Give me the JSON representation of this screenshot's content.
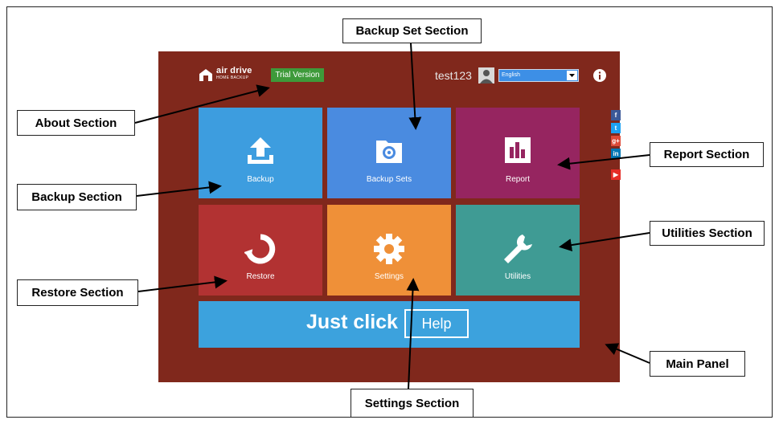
{
  "app": {
    "brand": "air drive",
    "brand_sub": "HOME BACKUP",
    "trial_label": "Trial Version",
    "username": "test123",
    "language": "English"
  },
  "tiles": [
    {
      "label": "Backup",
      "color": "#3d9ddf",
      "icon": "upload-icon"
    },
    {
      "label": "Backup Sets",
      "color": "#4a8be0",
      "icon": "folder-gear-icon"
    },
    {
      "label": "Report",
      "color": "#962560",
      "icon": "bar-chart-icon"
    },
    {
      "label": "Restore",
      "color": "#b23232",
      "icon": "restore-icon"
    },
    {
      "label": "Settings",
      "color": "#ef9038",
      "icon": "gear-icon"
    },
    {
      "label": "Utilities",
      "color": "#3f9b94",
      "icon": "wrench-icon"
    }
  ],
  "help_bar": {
    "text": "Just click",
    "button_label": "Help"
  },
  "social": [
    {
      "glyph": "f",
      "color": "#3b5998",
      "icon": "facebook-icon"
    },
    {
      "glyph": "t",
      "color": "#1da1f2",
      "icon": "twitter-icon"
    },
    {
      "glyph": "g+",
      "color": "#dd4b39",
      "icon": "google-plus-icon"
    },
    {
      "glyph": "in",
      "color": "#0077b5",
      "icon": "linkedin-icon"
    },
    {
      "glyph": "▶",
      "color": "#e52d27",
      "icon": "youtube-icon"
    }
  ],
  "callouts": {
    "backup_set": "Backup Set Section",
    "about": "About Section",
    "report": "Report Section",
    "backup": "Backup Section",
    "utilities": "Utilities Section",
    "restore": "Restore Section",
    "main_panel": "Main Panel",
    "settings": "Settings Section"
  }
}
